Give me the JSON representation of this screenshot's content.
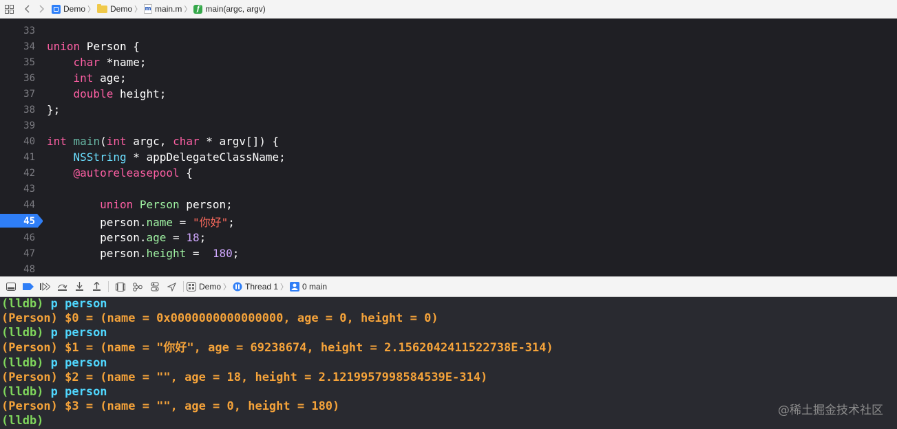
{
  "jumpbar": {
    "crumbs": [
      {
        "label": "Demo",
        "icon": "project-icon"
      },
      {
        "label": "Demo",
        "icon": "folder-icon"
      },
      {
        "label": "main.m",
        "icon": "objc-file-icon"
      },
      {
        "label": "main(argc, argv)",
        "icon": "function-icon"
      }
    ]
  },
  "editor": {
    "lines": [
      {
        "num": "33"
      },
      {
        "num": "34"
      },
      {
        "num": "35"
      },
      {
        "num": "36"
      },
      {
        "num": "37"
      },
      {
        "num": "38"
      },
      {
        "num": "39"
      },
      {
        "num": "40"
      },
      {
        "num": "41"
      },
      {
        "num": "42"
      },
      {
        "num": "43"
      },
      {
        "num": "44"
      },
      {
        "num": "45"
      },
      {
        "num": "46"
      },
      {
        "num": "47"
      },
      {
        "num": "48"
      }
    ],
    "code": {
      "l34a": "union",
      "l34b": " Person {",
      "l35a": "    ",
      "l35b": "char",
      "l35c": " *name;",
      "l36a": "    ",
      "l36b": "int",
      "l36c": " age;",
      "l37a": "    ",
      "l37b": "double",
      "l37c": " height;",
      "l38": "};",
      "l40a": "int",
      "l40b": " ",
      "l40c": "main",
      "l40d": "(",
      "l40e": "int",
      "l40f": " argc, ",
      "l40g": "char",
      "l40h": " * argv[]) {",
      "l41a": "    ",
      "l41b": "NSString",
      "l41c": " * appDelegateClassName;",
      "l42a": "    ",
      "l42b": "@autoreleasepool",
      "l42c": " {",
      "l44a": "        ",
      "l44b": "union",
      "l44c": " ",
      "l44d": "Person",
      "l44e": " person;",
      "l45a": "        person.",
      "l45b": "name",
      "l45c": " = ",
      "l45d": "\"你好\"",
      "l45e": ";",
      "l46a": "        person.",
      "l46b": "age",
      "l46c": " = ",
      "l46d": "18",
      "l46e": ";",
      "l47a": "        person.",
      "l47b": "height",
      "l47c": " =  ",
      "l47d": "180",
      "l47e": ";"
    },
    "breakpoint_line": "45",
    "colors": {
      "background": "#1f1f24",
      "breakpoint": "#2f7ef6"
    }
  },
  "debugbar": {
    "scheme": "Demo",
    "thread": "Thread 1",
    "frame": "0 main"
  },
  "console": {
    "lines": [
      {
        "prompt": "(lldb)",
        "cmd": " p person"
      },
      {
        "out": "(Person) $0 = (name = 0x0000000000000000, age = 0, height = 0)"
      },
      {
        "prompt": "(lldb)",
        "cmd": " p person"
      },
      {
        "out": "(Person) $1 = (name = \"你好\", age = 69238674, height = 2.1562042411522738E-314)"
      },
      {
        "prompt": "(lldb)",
        "cmd": " p person"
      },
      {
        "out": "(Person) $2 = (name = \"\", age = 18, height = 2.1219957998584539E-314)"
      },
      {
        "prompt": "(lldb)",
        "cmd": " p person"
      },
      {
        "out": "(Person) $3 = (name = \"\", age = 0, height = 180)"
      },
      {
        "prompt": "(lldb)",
        "cmd": ""
      }
    ],
    "watermark": "@稀土掘金技术社区"
  }
}
